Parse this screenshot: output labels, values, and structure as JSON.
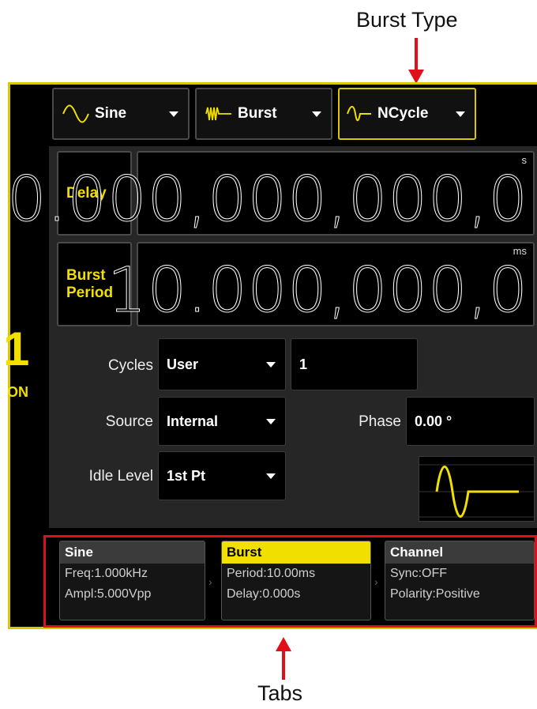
{
  "callouts": {
    "burst_type": "Burst Type",
    "tabs": "Tabs"
  },
  "channel": {
    "number": "1",
    "state": "ON"
  },
  "top_bar": {
    "waveform": "Sine",
    "mode": "Burst",
    "burst_type": "NCycle"
  },
  "delay": {
    "label": "Delay",
    "value": "0.000,000,000,0",
    "unit": "s"
  },
  "burst_period": {
    "label_line1": "Burst",
    "label_line2": "Period",
    "value": "10.000,000,0",
    "unit": "ms"
  },
  "cycles": {
    "label": "Cycles",
    "mode": "User",
    "value": "1"
  },
  "source": {
    "label": "Source",
    "value": "Internal"
  },
  "phase": {
    "label": "Phase",
    "value": "0.00 °"
  },
  "idle_level": {
    "label": "Idle Level",
    "value": "1st Pt"
  },
  "tabs": [
    {
      "title": "Sine",
      "line1": "Freq:1.000kHz",
      "line2": "Ampl:5.000Vpp",
      "active": false
    },
    {
      "title": "Burst",
      "line1": "Period:10.00ms",
      "line2": "Delay:0.000s",
      "active": true
    },
    {
      "title": "Channel",
      "line1": "Sync:OFF",
      "line2": "Polarity:Positive",
      "active": false
    }
  ],
  "colors": {
    "accent": "#f1df00",
    "callout": "#e0101a",
    "background": "#000000",
    "panel": "#262626"
  },
  "icons": {
    "waveform": "sine-wave-icon",
    "mode": "burst-icon",
    "burst_type": "ncycle-icon"
  }
}
